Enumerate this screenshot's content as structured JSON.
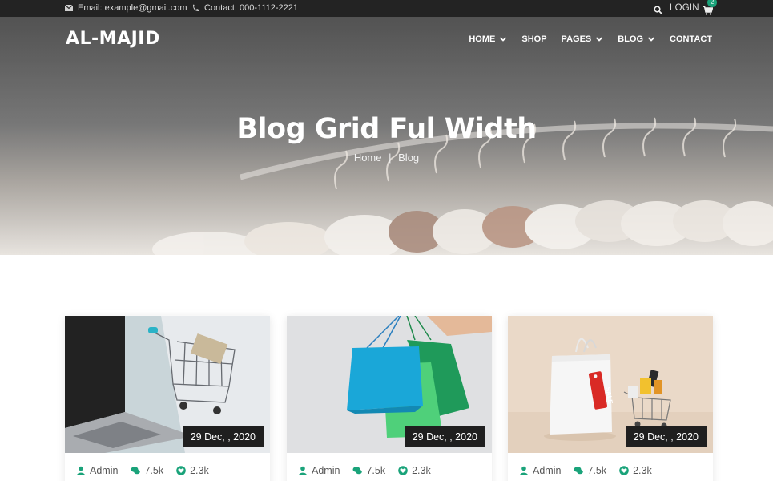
{
  "topbar": {
    "email": "Email: example@gmail.com",
    "contact": "Contact: 000-1112-2221",
    "login": "LOGIN",
    "cart_count": "2",
    "icons": [
      "envelope-icon",
      "phone-icon",
      "search-icon",
      "cart-icon"
    ]
  },
  "header": {
    "logo": "AL-MAJID",
    "nav": [
      {
        "label": "HOME",
        "dropdown": true
      },
      {
        "label": "SHOP",
        "dropdown": false
      },
      {
        "label": "PAGES",
        "dropdown": true
      },
      {
        "label": "BLOG",
        "dropdown": true
      },
      {
        "label": "CONTACT",
        "dropdown": false
      }
    ]
  },
  "hero": {
    "title": "Blog Grid Ful Width",
    "breadcrumb": {
      "home": "Home",
      "separator": "|",
      "current": "Blog"
    }
  },
  "posts": [
    {
      "date": "29 Dec, , 2020",
      "author": "Admin",
      "comments": "7.5k",
      "likes": "2.3k",
      "image": "laptop-shopping-cart"
    },
    {
      "date": "29 Dec, , 2020",
      "author": "Admin",
      "comments": "7.5k",
      "likes": "2.3k",
      "image": "shopping-bags"
    },
    {
      "date": "29 Dec, , 2020",
      "author": "Admin",
      "comments": "7.5k",
      "likes": "2.3k",
      "image": "sale-bag-cart"
    }
  ],
  "colors": {
    "accent": "#1aa37a",
    "topbar": "#232323",
    "badge": "#1f1f1f"
  }
}
